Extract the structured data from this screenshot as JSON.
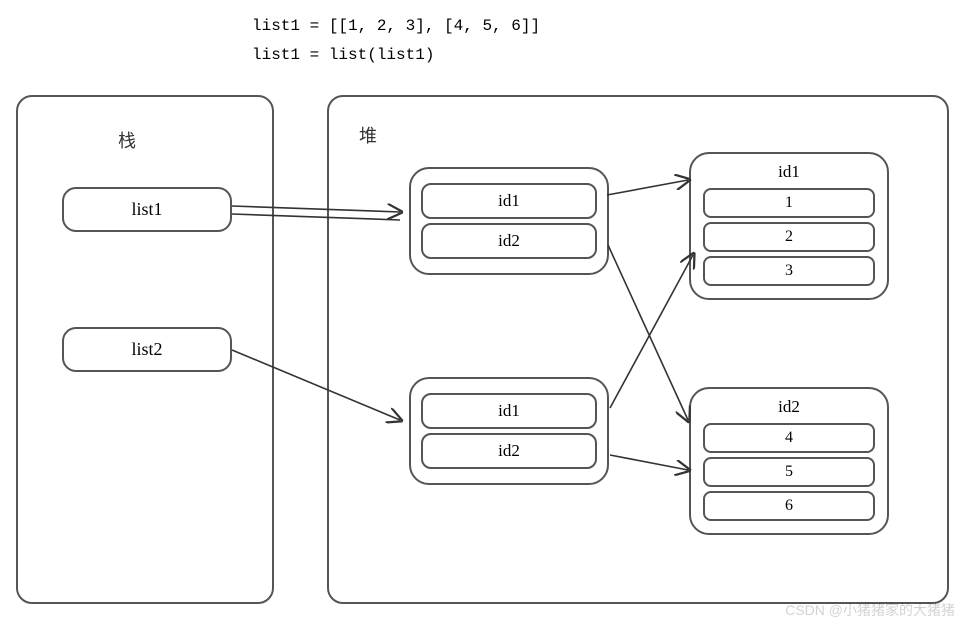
{
  "code": {
    "line1": "list1 = [[1, 2, 3], [4, 5, 6]]",
    "line2": "list1 = list(list1)"
  },
  "stack": {
    "label": "栈",
    "vars": {
      "v1": "list1",
      "v2": "list2"
    }
  },
  "heap": {
    "label": "堆",
    "innerA": {
      "s1": "id1",
      "s2": "id2"
    },
    "innerB": {
      "s1": "id1",
      "s2": "id2"
    },
    "valA": {
      "title": "id1",
      "c1": "1",
      "c2": "2",
      "c3": "3"
    },
    "valB": {
      "title": "id2",
      "c1": "4",
      "c2": "5",
      "c3": "6"
    }
  },
  "watermark": "CSDN @小猪猪家的大猪猪"
}
